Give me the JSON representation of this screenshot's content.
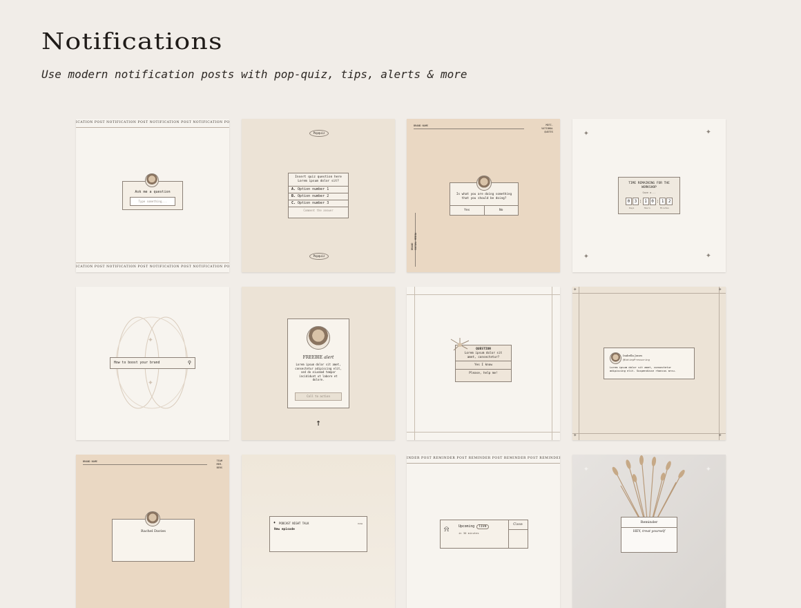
{
  "header": {
    "title": "Notifications",
    "subtitle": "Use modern notification posts with pop-quiz, tips, alerts & more"
  },
  "tiles": {
    "ask": {
      "strip_top": "ICATION POST NOTIFICATION POST NOTIFICATION POST NOTIFICATION POST NOTIFICATION",
      "strip_bottom": "ICATION POST NOTIFICATION POST NOTIFICATION POST NOTIFICATION POST NOTIFICATION",
      "prompt": "Ask me a question",
      "placeholder": "Type something..."
    },
    "quiz": {
      "badge_top": "Popquiz",
      "badge_bottom": "Popquiz",
      "question": "Insert quiz question here Lorem ipsum dolor sit?",
      "options": [
        {
          "letter": "A.",
          "text": "Option number 1"
        },
        {
          "letter": "B.",
          "text": "Option number 2"
        },
        {
          "letter": "C.",
          "text": "Option number 3"
        }
      ],
      "footer": "Comment the answer"
    },
    "motivation": {
      "brand": "BRAND NAME",
      "corner": "MOTI-\nVATIONAL\nQUOTES",
      "question": "Is what you are doing something that you should be doing?",
      "yes": "Yes",
      "no": "No",
      "side": "BRAND\nSOCIAL MEDIA"
    },
    "timer": {
      "title": "TIME REMAINING FOR THE WORKSHOP",
      "sub": "Save a...",
      "digits": [
        "0",
        "3",
        "1",
        "0",
        "1",
        "2"
      ],
      "units": [
        "Days",
        "Hours",
        "Minutes"
      ]
    },
    "search": {
      "query": "How to boost your brand"
    },
    "freebie": {
      "heading_a": "FREEBIE",
      "heading_b": "alert",
      "body": "Lorem ipsum dolor sit amet, consectetur adipiscing elit, sed do eiusmod tempor incididunt ut labore et dolore.",
      "cta": "Call to action",
      "arrow": "↑"
    },
    "question": {
      "title": "QUESTION",
      "body": "Lorem ipsum dolor sit amet, consectetur?",
      "answer1": "Yes I know",
      "answer2": "Please, help me!"
    },
    "tweet": {
      "name": "Isabella Jones",
      "handle": "@KatiepPressoring",
      "body": "Lorem ipsum dolor sit amet, consectetur adipiscing elit. Suspendisse rhoncus arcu."
    },
    "profile": {
      "brand": "BRAND NAME",
      "corner": "TEAM\nMEM-\nBERS",
      "name": "Rachel Davies"
    },
    "podcast": {
      "show": "PODCAST NIGHT TALK",
      "time": "now",
      "title": "New episode"
    },
    "upcoming": {
      "strip_top": "INDER POST REMINDER POST REMINDER POST REMINDER POST REMINDER POST REMINDER",
      "label_a": "Upcoming",
      "label_b": "live",
      "time": "in 30 minutes",
      "close": "Close"
    },
    "reminder": {
      "title": "Reminder",
      "body_a": "HEY,",
      "body_b": "treat yourself"
    }
  },
  "colors": {
    "background": "#f1ede8",
    "cream": "#f5f1ea",
    "beige": "#ece3d6",
    "tan": "#ead8c3",
    "line": "#8b8076"
  }
}
